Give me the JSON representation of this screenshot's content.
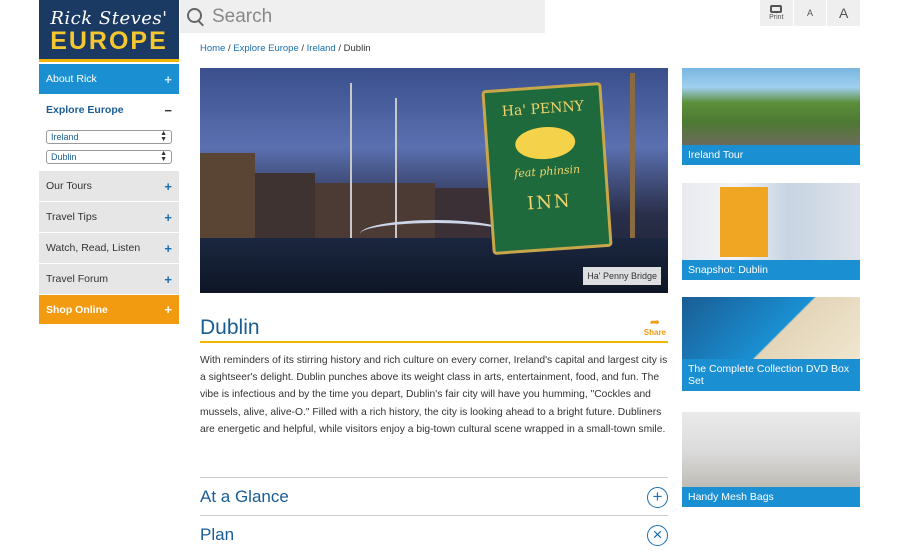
{
  "logo": {
    "line1": "Rick Steves'",
    "line2": "EUROPE"
  },
  "search": {
    "placeholder": "Search"
  },
  "tools": {
    "print": "Print",
    "font_small": "A",
    "font_large": "A"
  },
  "sidebar": {
    "items": [
      {
        "label": "About Rick",
        "sign": "+"
      },
      {
        "label": "Explore Europe",
        "sign": "−"
      },
      {
        "label": "Our Tours",
        "sign": "+"
      },
      {
        "label": "Travel Tips",
        "sign": "+"
      },
      {
        "label": "Watch, Read, Listen",
        "sign": "+"
      },
      {
        "label": "Travel Forum",
        "sign": "+"
      },
      {
        "label": "Shop Online",
        "sign": "+"
      }
    ],
    "country_select": "Ireland",
    "city_select": "Dublin"
  },
  "breadcrumb": {
    "home": "Home",
    "explore": "Explore Europe",
    "country": "Ireland",
    "current": "Dublin",
    "sep": "/"
  },
  "hero": {
    "caption": "Ha' Penny Bridge",
    "sign_top": "Ha' PENNY",
    "sign_mid": "feat phinsin",
    "sign_bottom": "INN"
  },
  "page": {
    "title": "Dublin",
    "share": "Share",
    "body": "With reminders of its stirring history and rich culture on every corner, Ireland's capital and largest city is a sightseer's delight. Dublin punches above its weight class in arts, entertainment, food, and fun. The vibe is infectious and by the time you depart, Dublin's fair city will have you humming, \"Cockles and mussels, alive, alive-O.\" Filled with a rich history, the city is looking ahead to a bright future. Dubliners are energetic and helpful, while visitors enjoy a big-town cultural scene wrapped in a small-town smile."
  },
  "accordions": [
    {
      "label": "At a Glance",
      "icon": "+"
    },
    {
      "label": "Plan",
      "icon": "×"
    }
  ],
  "promos": [
    {
      "caption": "Ireland Tour"
    },
    {
      "caption": "Snapshot: Dublin"
    },
    {
      "caption": "The Complete Collection DVD Box Set"
    },
    {
      "caption": "Handy Mesh Bags"
    }
  ]
}
